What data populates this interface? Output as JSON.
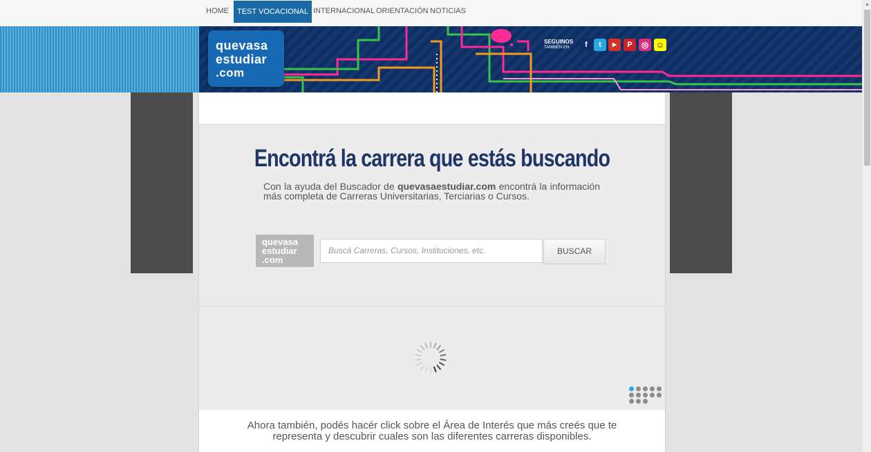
{
  "nav": {
    "items": [
      {
        "label": "HOME",
        "active": false
      },
      {
        "label": "TEST VOCACIONAL",
        "active": true
      },
      {
        "label": "INTERNACIONAL",
        "active": false
      },
      {
        "label": "ORIENTACIÓN",
        "active": false
      },
      {
        "label": "NOTICIAS",
        "active": false
      }
    ]
  },
  "banner": {
    "logo_line1": "quevasa",
    "logo_line2": "estudiar",
    "logo_line3": ".com",
    "social_label": "SEGUINOS",
    "social_sublabel": "TAMBIÉN EN",
    "social_icons": [
      "facebook-icon",
      "twitter-icon",
      "youtube-icon",
      "pinterest-icon",
      "instagram-icon",
      "snapchat-icon"
    ]
  },
  "main": {
    "headline": "Encontrá la carrera que estás buscando",
    "subtext_prefix": "Con la ayuda del Buscador de ",
    "subtext_brand": "quevasaestudiar.com",
    "subtext_suffix": " encontrá la información más completa de Carreras Universitarias, Terciarias o Cursos."
  },
  "search": {
    "logo_line1": "quevasa",
    "logo_line2": "estudiar",
    "logo_line3": ".com",
    "placeholder": "Buscá Carreras, Cursos, Instituciones, etc.",
    "button_label": "BUSCAR"
  },
  "footer": {
    "text": "Ahora también, podés hacér click sobre el Área de Interés que más creés que te representa y descubrir cuales son las diferentes carreras disponibles."
  },
  "colors": {
    "nav_active": "#1a6aa7",
    "banner_bg": "#0d2f66",
    "headline": "#1f3565",
    "side_panel": "#4c4c4c"
  }
}
